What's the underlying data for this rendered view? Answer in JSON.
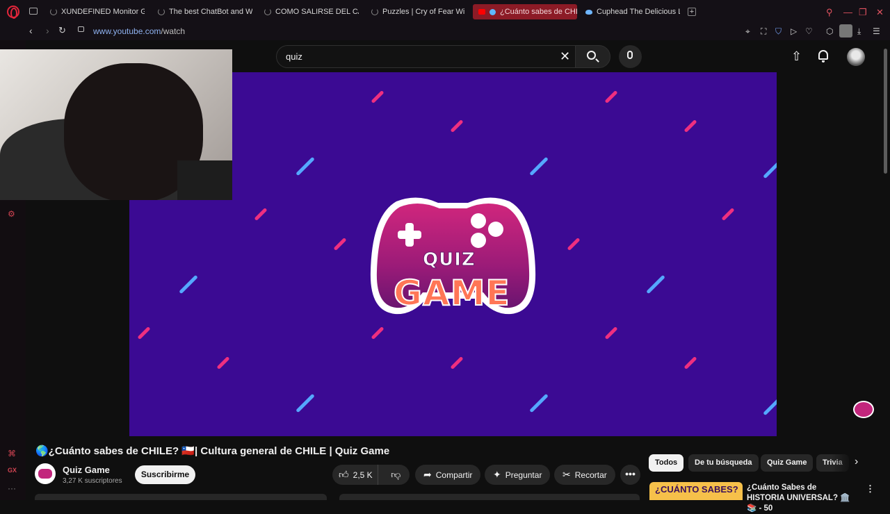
{
  "browser": {
    "tabs": [
      {
        "title": "XUNDEFINED Monitor Gan",
        "state": "loading"
      },
      {
        "title": "The best ChatBot and Wid",
        "state": "loading"
      },
      {
        "title": "COMO SALIRSE DEL CAN",
        "state": "loading"
      },
      {
        "title": "Puzzles | Cry of Fear Wiki",
        "state": "loading"
      },
      {
        "title": "¿Cuánto sabes de CHIL",
        "state": "active"
      },
      {
        "title": "Cuphead The Delicious La",
        "state": "idle"
      }
    ],
    "new_tab_label": "+",
    "url_domain": "www.youtube.com",
    "url_path": "/watch",
    "accent_color": "#e3263b"
  },
  "youtube": {
    "search_value": "quiz",
    "video": {
      "title": "🌎¿Cuánto sabes de CHILE? 🇨🇱| Cultura general de CHILE | Quiz Game",
      "artwork_top": "QUIZ",
      "artwork_bottom": "GAME",
      "background_color": "#3b0a93"
    },
    "channel": {
      "name": "Quiz Game",
      "subscribers": "3,27 K suscriptores",
      "subscribe_label": "Suscribirme"
    },
    "actions": {
      "likes": "2,5 K",
      "share_label": "Compartir",
      "ask_label": "Preguntar",
      "clip_label": "Recortar",
      "more_label": "•••"
    },
    "chips": [
      "Todos",
      "De tu búsqueda",
      "Quiz Game",
      "Trivia"
    ],
    "recommendation": {
      "thumb_text": "¿CUÁNTO SABES?",
      "title": "¿Cuánto Sabes de HISTORIA UNIVERSAL? 🏛️📚 - 50"
    }
  }
}
